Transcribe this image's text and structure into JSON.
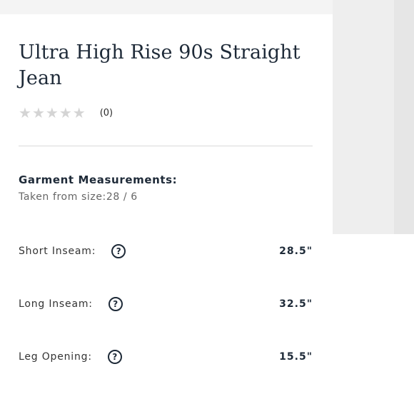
{
  "product": {
    "title": "Ultra High Rise 90s Straight Jean",
    "rating": {
      "stars": 0,
      "max_stars": 5,
      "count_label": "(0)"
    }
  },
  "measurements": {
    "heading": "Garment Measurements:",
    "taken_from": "Taken from size:28 / 6",
    "rows": [
      {
        "label": "Short Inseam:",
        "help": "?",
        "value": "28.5\""
      },
      {
        "label": "Long Inseam:",
        "help": "?",
        "value": "32.5\""
      },
      {
        "label": "Leg Opening:",
        "help": "?",
        "value": "15.5\""
      }
    ]
  },
  "colors": {
    "text_primary": "#1e2a38",
    "star_empty": "#d4d4d4",
    "divider": "#d9d9d9"
  }
}
